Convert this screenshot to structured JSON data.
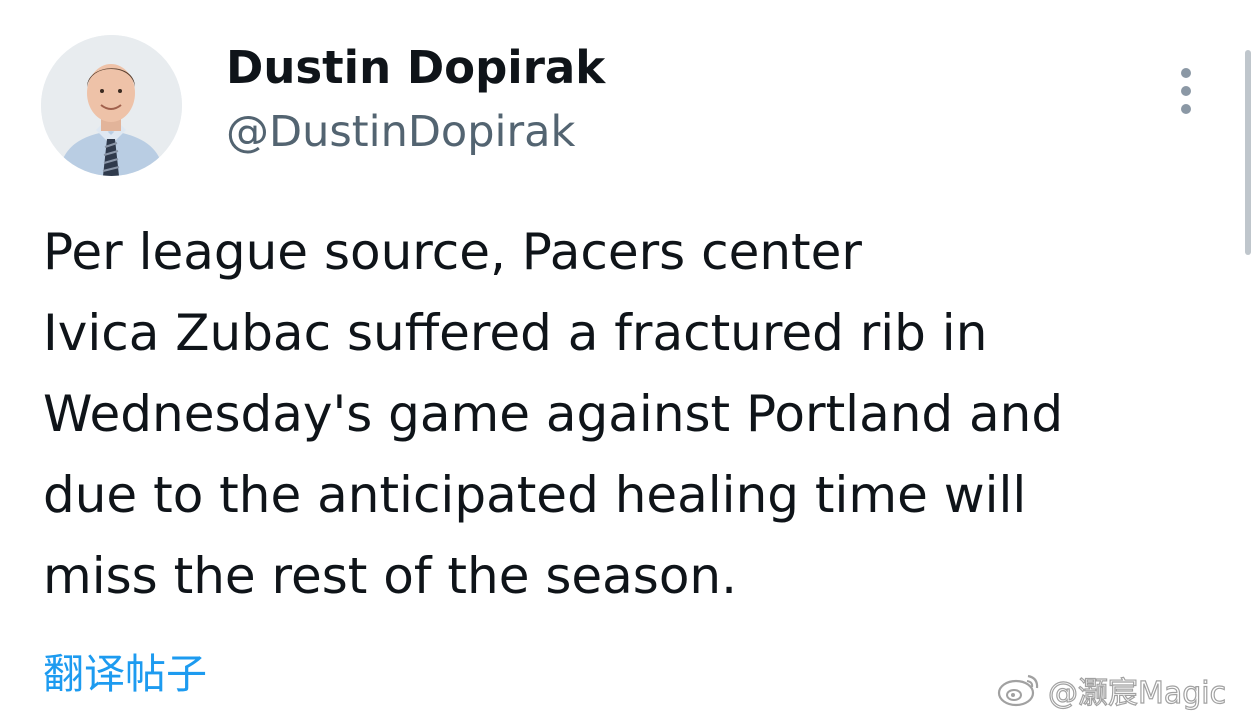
{
  "author": {
    "display_name": "Dustin Dopirak",
    "handle": "@DustinDopirak",
    "avatar": "avatar-photo"
  },
  "tweet": {
    "lines": [
      "Per league source, Pacers center",
      "Ivica Zubac suffered a fractured rib in",
      "Wednesday's game against Portland and",
      "due to the anticipated healing time will",
      "miss the rest of the season."
    ]
  },
  "actions": {
    "more_icon": "more-vertical-icon",
    "translate_label": "翻译帖子"
  },
  "watermark": {
    "text": "@灏宸Magic",
    "icon": "weibo-icon"
  },
  "colors": {
    "text": "#0f1419",
    "secondary_text": "#536471",
    "link": "#1d9bf0",
    "background": "#ffffff"
  }
}
